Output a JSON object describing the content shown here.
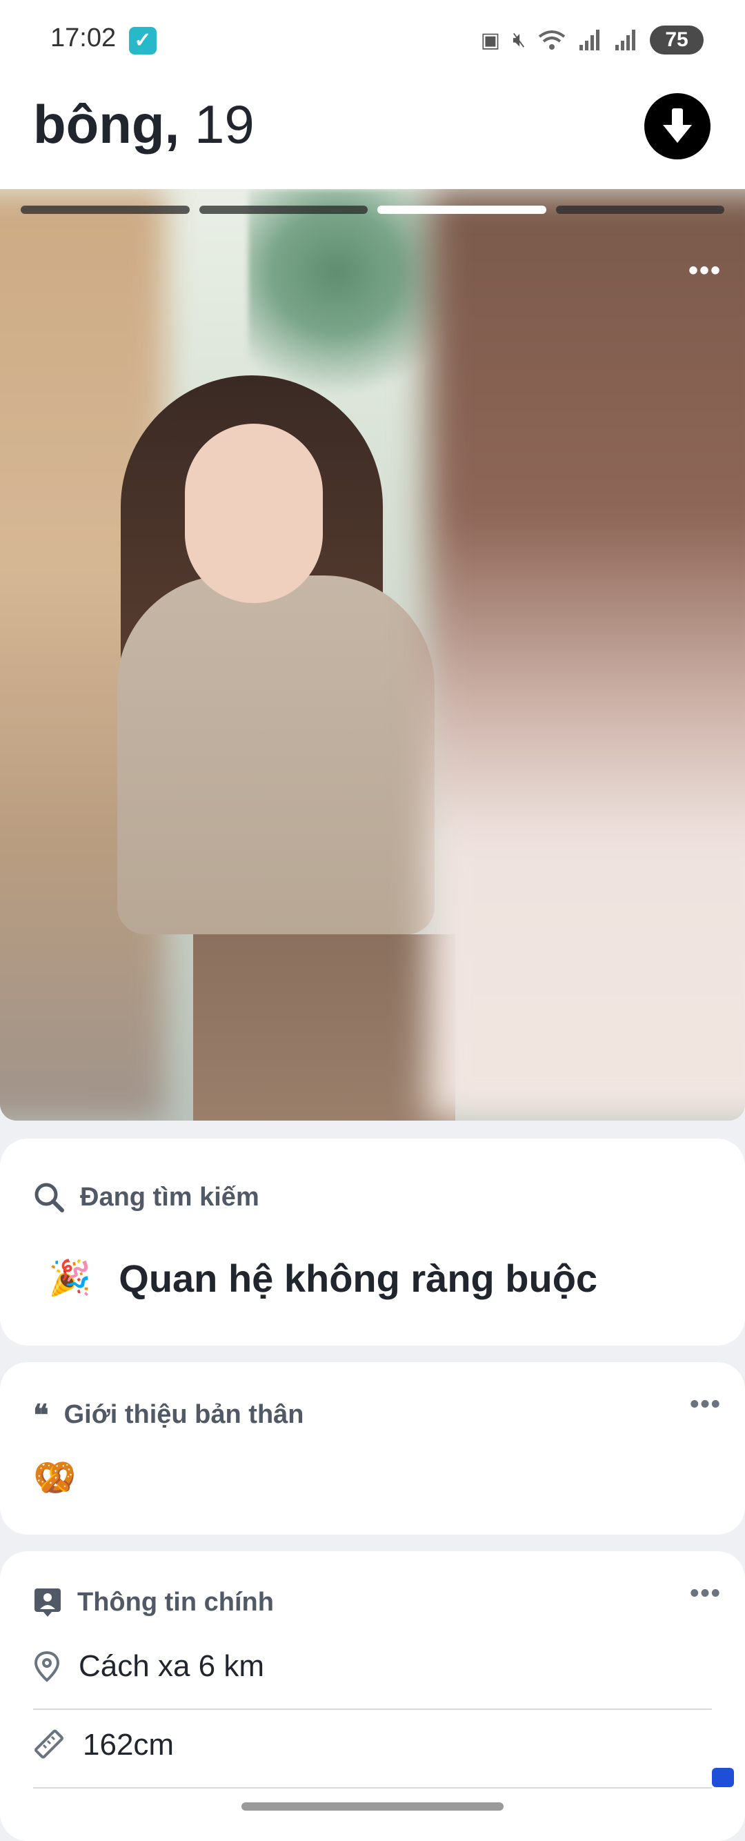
{
  "status_bar": {
    "time": "17:02",
    "battery": "75"
  },
  "header": {
    "name": "bông,",
    "age": "19"
  },
  "photo": {
    "segments": 4,
    "active_index": 2
  },
  "looking_for": {
    "title": "Đang tìm kiếm",
    "emoji": "🎉",
    "value": "Quan hệ không ràng buộc"
  },
  "about": {
    "title": "Giới thiệu bản thân",
    "quote_glyph": "❝",
    "emoji": "🥨"
  },
  "basics": {
    "title": "Thông tin chính",
    "distance": "Cách xa 6 km",
    "height": "162cm"
  },
  "more_glyph": "•••",
  "colors": {
    "accent": "#000000",
    "text": "#21262e",
    "muted": "#505965",
    "check": "#27b9c9"
  }
}
